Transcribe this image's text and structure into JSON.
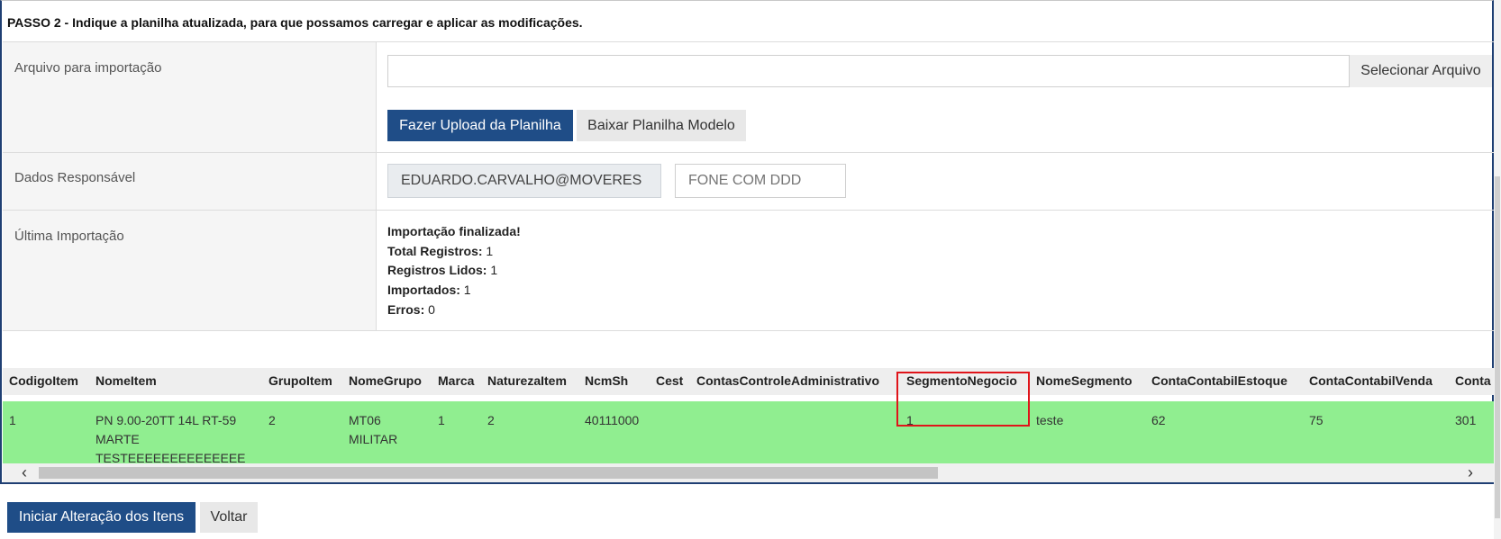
{
  "step_title": "PASSO 2 - Indique a planilha atualizada, para que possamos carregar e aplicar as modificações.",
  "file_section": {
    "label": "Arquivo para importação",
    "file_value": "",
    "select_button": "Selecionar Arquivo",
    "upload_button": "Fazer Upload da Planilha",
    "download_button": "Baixar Planilha Modelo"
  },
  "responsavel": {
    "label": "Dados Responsável",
    "email_value": "EDUARDO.CARVALHO@MOVERES",
    "phone_placeholder": "FONE COM DDD"
  },
  "ultima_importacao": {
    "label": "Última Importação",
    "status": "Importação finalizada!",
    "total_label": "Total Registros:",
    "total_value": "1",
    "lidos_label": "Registros Lidos:",
    "lidos_value": "1",
    "importados_label": "Importados:",
    "importados_value": "1",
    "erros_label": "Erros:",
    "erros_value": "0"
  },
  "table": {
    "columns": [
      "CodigoItem",
      "NomeItem",
      "GrupoItem",
      "NomeGrupo",
      "Marca",
      "NaturezaItem",
      "NcmSh",
      "Cest",
      "ContasControleAdministrativo",
      "SegmentoNegocio",
      "NomeSegmento",
      "ContaContabilEstoque",
      "ContaContabilVenda",
      "Conta"
    ],
    "row": {
      "CodigoItem": "1",
      "NomeItem_l1": "PN 9.00-20TT 14L RT-59",
      "NomeItem_l2": "MARTE",
      "NomeItem_l3": "TESTEEEEEEEEEEEEEE",
      "GrupoItem": "2",
      "NomeGrupo_l1": "MT06",
      "NomeGrupo_l2": "MILITAR",
      "Marca": "1",
      "NaturezaItem": "2",
      "NcmSh": "40111000",
      "Cest": "",
      "ContasControleAdministrativo": "",
      "SegmentoNegocio": "1",
      "NomeSegmento": "teste",
      "ContaContabilEstoque": "62",
      "ContaContabilVenda": "75",
      "Conta": "301"
    },
    "row_color": "#90ee90",
    "highlight_column": "SegmentoNegocio",
    "horizontal_scroll_fraction": 0.62
  },
  "footer": {
    "start_button": "Iniciar Alteração dos Itens",
    "back_button": "Voltar"
  },
  "colors": {
    "primary": "#1f4d87",
    "highlight_border": "#e0141a",
    "panel_border": "#1f3f73"
  },
  "icons": {
    "scroll_left": "chevron-left-icon",
    "scroll_right": "chevron-right-icon"
  }
}
